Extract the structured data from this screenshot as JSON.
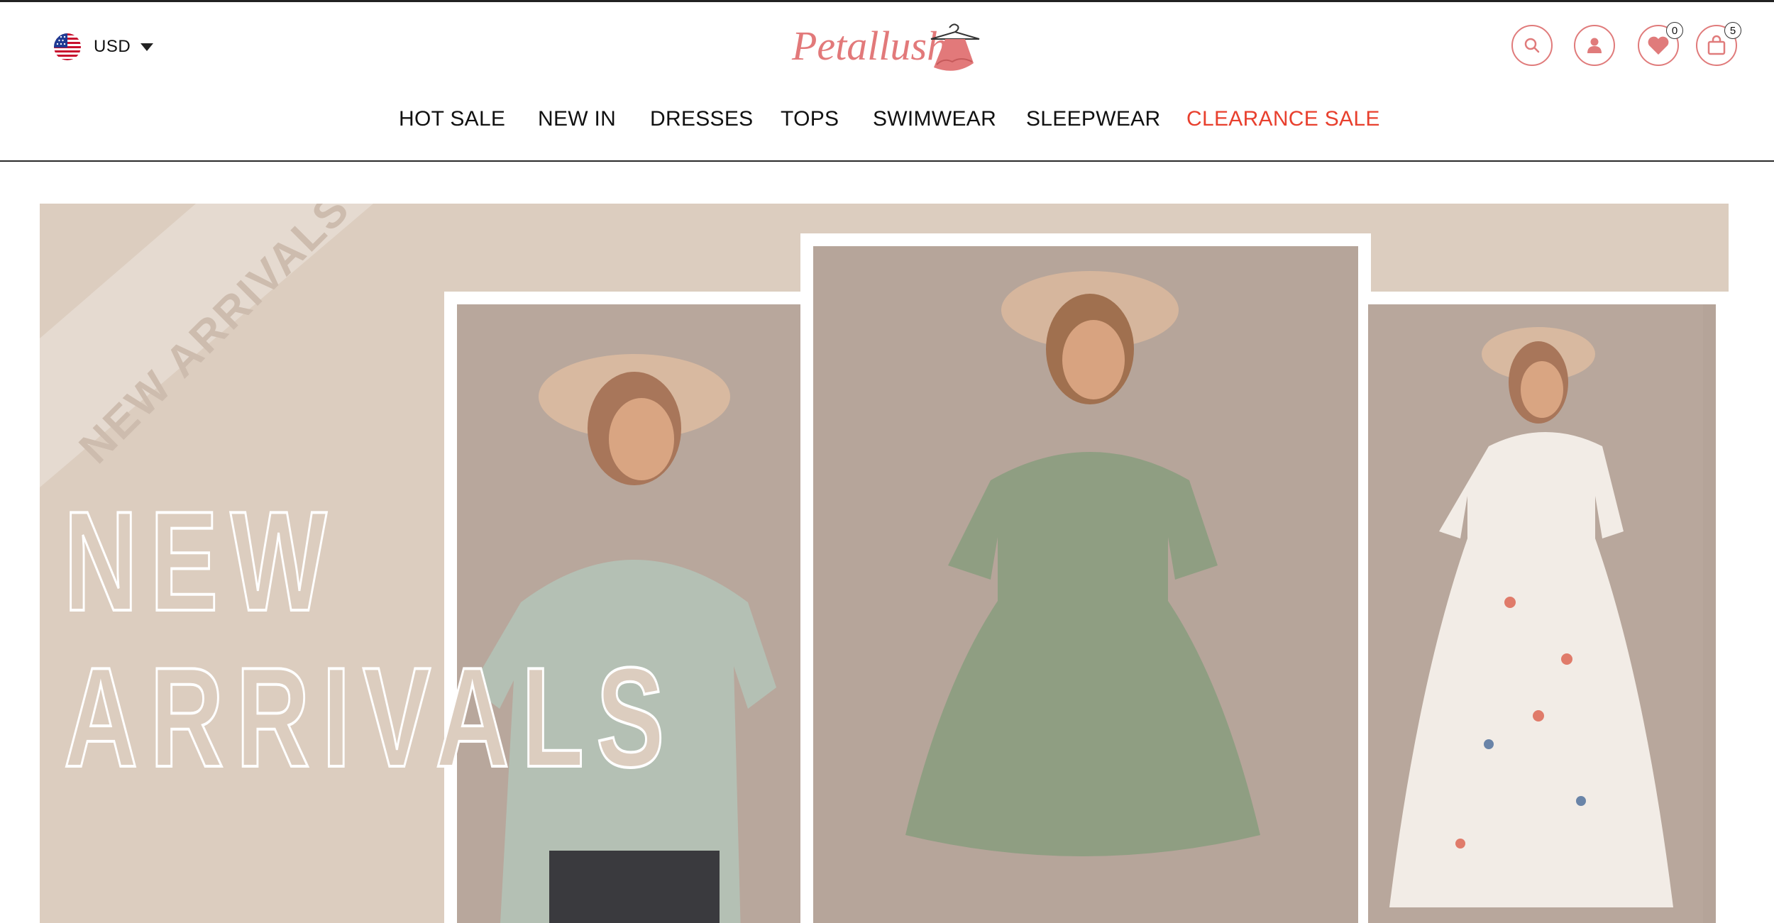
{
  "header": {
    "currency": {
      "label": "USD",
      "flag": "us-flag"
    },
    "logo": {
      "text": "Petallush",
      "color": "#e2797a"
    },
    "icons": {
      "search": "search-icon",
      "account": "user-icon",
      "wishlist": {
        "icon": "heart-icon",
        "count": "0"
      },
      "cart": {
        "icon": "bag-icon",
        "count": "5"
      }
    },
    "nav": [
      {
        "label": "HOT SALE"
      },
      {
        "label": "NEW IN"
      },
      {
        "label": "DRESSES"
      },
      {
        "label": "TOPS"
      },
      {
        "label": "SWIMWEAR"
      },
      {
        "label": "SLEEPWEAR"
      },
      {
        "label": "CLEARANCE SALE",
        "color": "#e8402e"
      }
    ]
  },
  "banner": {
    "ribbon_text": "NEW ARRIVALS",
    "headline_line1": "NEW",
    "headline_line2": "ARRIVALS",
    "background_color": "#dccdbf"
  },
  "colors": {
    "accent": "#e07b7b",
    "sale": "#e8402e"
  }
}
